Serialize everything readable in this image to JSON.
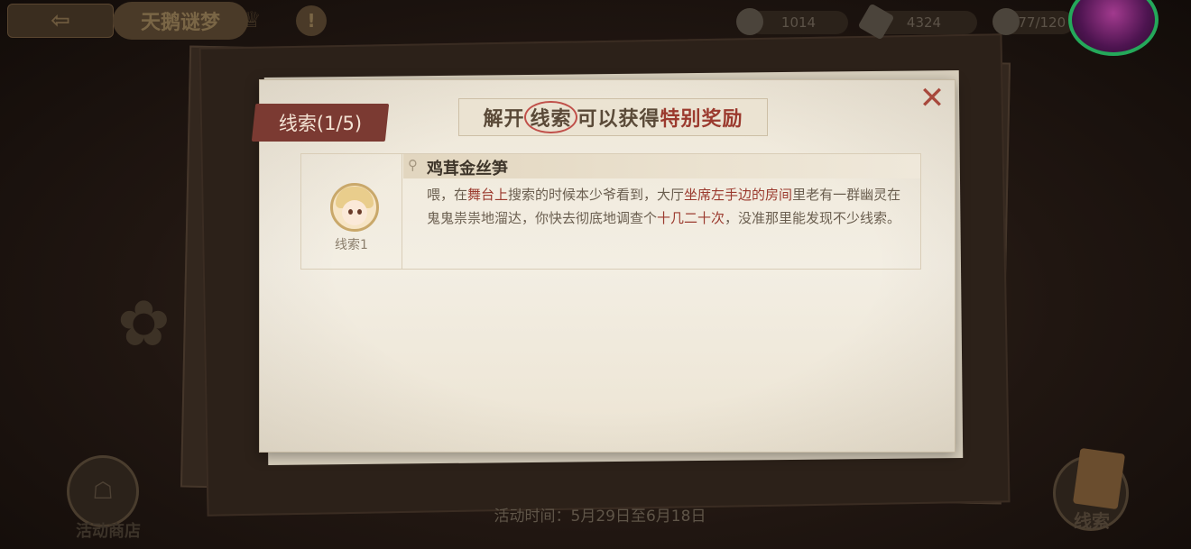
{
  "top_bar": {
    "back_icon": "back-arrow-icon",
    "event_title": "天鹅谜梦",
    "resources": [
      {
        "icon": "stopwatch-icon",
        "value": "1014"
      },
      {
        "icon": "ticket-icon",
        "value": "4324"
      },
      {
        "icon": "bowl-icon",
        "value": "877/120"
      }
    ]
  },
  "popup": {
    "tab_label": "线索(1/5)",
    "banner": {
      "part1": "解开",
      "circled": "线索",
      "part2": "可以获得",
      "highlight": "特别奖励"
    },
    "clue": {
      "avatar_label": "线索1",
      "title": "鸡茸金丝笋",
      "body": [
        {
          "text": "喂，在",
          "hl": false
        },
        {
          "text": "舞台上",
          "hl": true
        },
        {
          "text": "搜索的时候本少爷看到，大厅",
          "hl": false
        },
        {
          "text": "坐席左手边的房间",
          "hl": true
        },
        {
          "text": "里老有一群幽灵在鬼鬼祟祟地溜达，你快去彻底地调查个",
          "hl": false
        },
        {
          "text": "十几二十次",
          "hl": true
        },
        {
          "text": "，没准那里能发现不少线索。",
          "hl": false
        }
      ]
    }
  },
  "bottom": {
    "shop_label": "活动商店",
    "event_time": "活动时间：5月29日至6月18日",
    "clue_button_label": "线索"
  },
  "colors": {
    "accent_red": "#9b3a2e",
    "tab_bg": "#7b3a32",
    "parchment": "#efe8d9"
  }
}
